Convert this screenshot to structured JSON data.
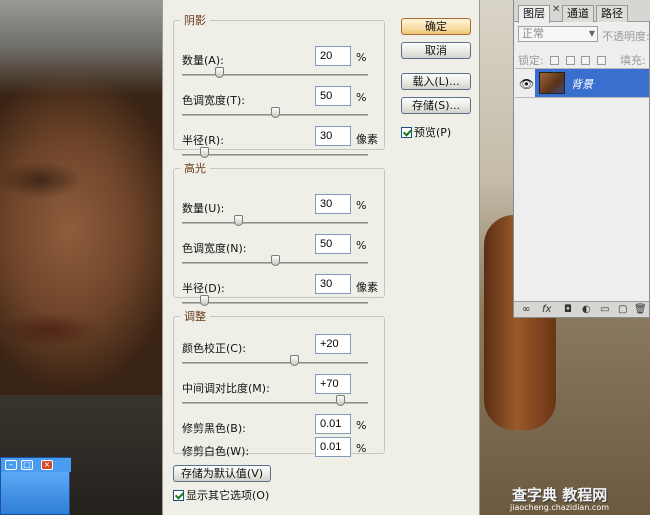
{
  "dialog": {
    "buttons": {
      "ok": "确定",
      "cancel": "取消",
      "load": "载入(L)...",
      "save": "存储(S)...",
      "preview": "预览(P)",
      "save_default": "存储为默认值(V)",
      "show_more": "显示其它选项(O)"
    },
    "preview_checked": true,
    "show_more_checked": true,
    "shadows": {
      "title": "阴影",
      "amount": {
        "label": "数量(A):",
        "value": "20",
        "unit": "%",
        "slider": 0.2
      },
      "tonal_width": {
        "label": "色调宽度(T):",
        "value": "50",
        "unit": "%",
        "slider": 0.5
      },
      "radius": {
        "label": "半径(R):",
        "value": "30",
        "unit": "像素",
        "slider": 0.12
      }
    },
    "highlights": {
      "title": "高光",
      "amount": {
        "label": "数量(U):",
        "value": "30",
        "unit": "%",
        "slider": 0.3
      },
      "tonal_width": {
        "label": "色调宽度(N):",
        "value": "50",
        "unit": "%",
        "slider": 0.5
      },
      "radius": {
        "label": "半径(D):",
        "value": "30",
        "unit": "像素",
        "slider": 0.12
      }
    },
    "adjustments": {
      "title": "调整",
      "color_correction": {
        "label": "颜色校正(C):",
        "value": "+20",
        "slider": 0.6
      },
      "midtone_contrast": {
        "label": "中间调对比度(M):",
        "value": "+70",
        "slider": 0.85
      },
      "black_clip": {
        "label": "修剪黑色(B):",
        "value": "0.01",
        "unit": "%"
      },
      "white_clip": {
        "label": "修剪白色(W):",
        "value": "0.01",
        "unit": "%"
      }
    }
  },
  "layers_panel": {
    "tabs": [
      "图层",
      "通道",
      "路径"
    ],
    "blend_mode": "正常",
    "opacity_label": "不透明度:",
    "lock_label": "锁定:",
    "fill_label": "填充:",
    "layer_name": "背景"
  },
  "watermark": {
    "text": "查字典 教程网",
    "url": "jiaocheng.chazidian.com"
  }
}
